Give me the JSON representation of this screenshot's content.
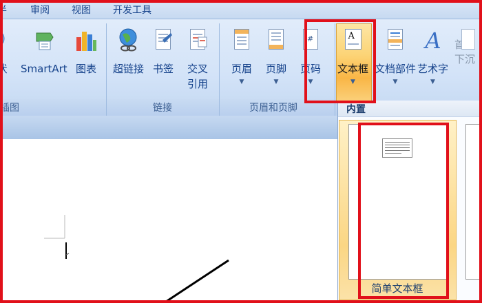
{
  "tabs": [
    "审阅",
    "视图",
    "开发工具"
  ],
  "ribbon": {
    "group_illustrations": {
      "name": "插图",
      "buttons": [
        {
          "label": "SmartArt",
          "icon": "smartart-icon"
        },
        {
          "label": "图表",
          "icon": "chart-icon"
        }
      ]
    },
    "group_links": {
      "name": "链接",
      "buttons": [
        {
          "label": "超链接",
          "icon": "hyperlink-globe-icon"
        },
        {
          "label": "书签",
          "icon": "bookmark-icon"
        },
        {
          "label": "交叉\n引用",
          "icon": "cross-reference-icon"
        }
      ]
    },
    "group_header_footer": {
      "name": "页眉和页脚",
      "buttons": [
        {
          "label": "页眉",
          "icon": "header-icon"
        },
        {
          "label": "页脚",
          "icon": "footer-icon"
        },
        {
          "label": "页码",
          "icon": "page-number-icon"
        }
      ]
    },
    "group_text": {
      "buttons": [
        {
          "label": "文本框",
          "icon": "textbox-icon",
          "pressed": true
        },
        {
          "label": "文档部件",
          "icon": "quick-parts-icon"
        },
        {
          "label": "艺术字",
          "icon": "wordart-icon"
        },
        {
          "label": "首字下沉",
          "icon": "drop-cap-icon"
        }
      ]
    }
  },
  "gallery": {
    "section_title": "内置",
    "items": [
      {
        "label": "简单文本框"
      }
    ]
  },
  "colors": {
    "highlight_red": "#e1101a",
    "ribbon_blue": "#d3e3f8",
    "pressed_orange": "#f9b646",
    "text_blue": "#15428b"
  }
}
